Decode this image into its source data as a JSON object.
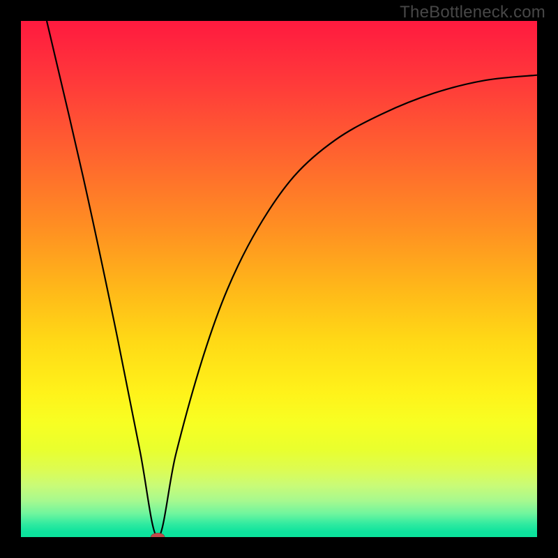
{
  "watermark": "TheBottleneck.com",
  "chart_data": {
    "type": "line",
    "title": "",
    "xlabel": "",
    "ylabel": "",
    "xlim": [
      0,
      1
    ],
    "ylim": [
      0,
      1
    ],
    "grid": false,
    "legend": false,
    "series": [
      {
        "name": "left-branch",
        "x": [
          0.05,
          0.12,
          0.18,
          0.23,
          0.265
        ],
        "y": [
          1.0,
          0.7,
          0.42,
          0.17,
          0.0
        ]
      },
      {
        "name": "right-branch",
        "x": [
          0.265,
          0.3,
          0.35,
          0.4,
          0.46,
          0.53,
          0.61,
          0.7,
          0.8,
          0.9,
          1.0
        ],
        "y": [
          0.0,
          0.16,
          0.34,
          0.48,
          0.6,
          0.7,
          0.77,
          0.82,
          0.86,
          0.885,
          0.895
        ]
      }
    ],
    "highlights": [
      {
        "name": "vertex",
        "x": 0.265,
        "y": 0.0
      }
    ],
    "colors": {
      "gradient_top": "#ff1a3f",
      "gradient_mid": "#ffd916",
      "gradient_bottom": "#0be39c",
      "curve": "#000000",
      "dot": "#c24a4a",
      "frame": "#000000"
    }
  }
}
